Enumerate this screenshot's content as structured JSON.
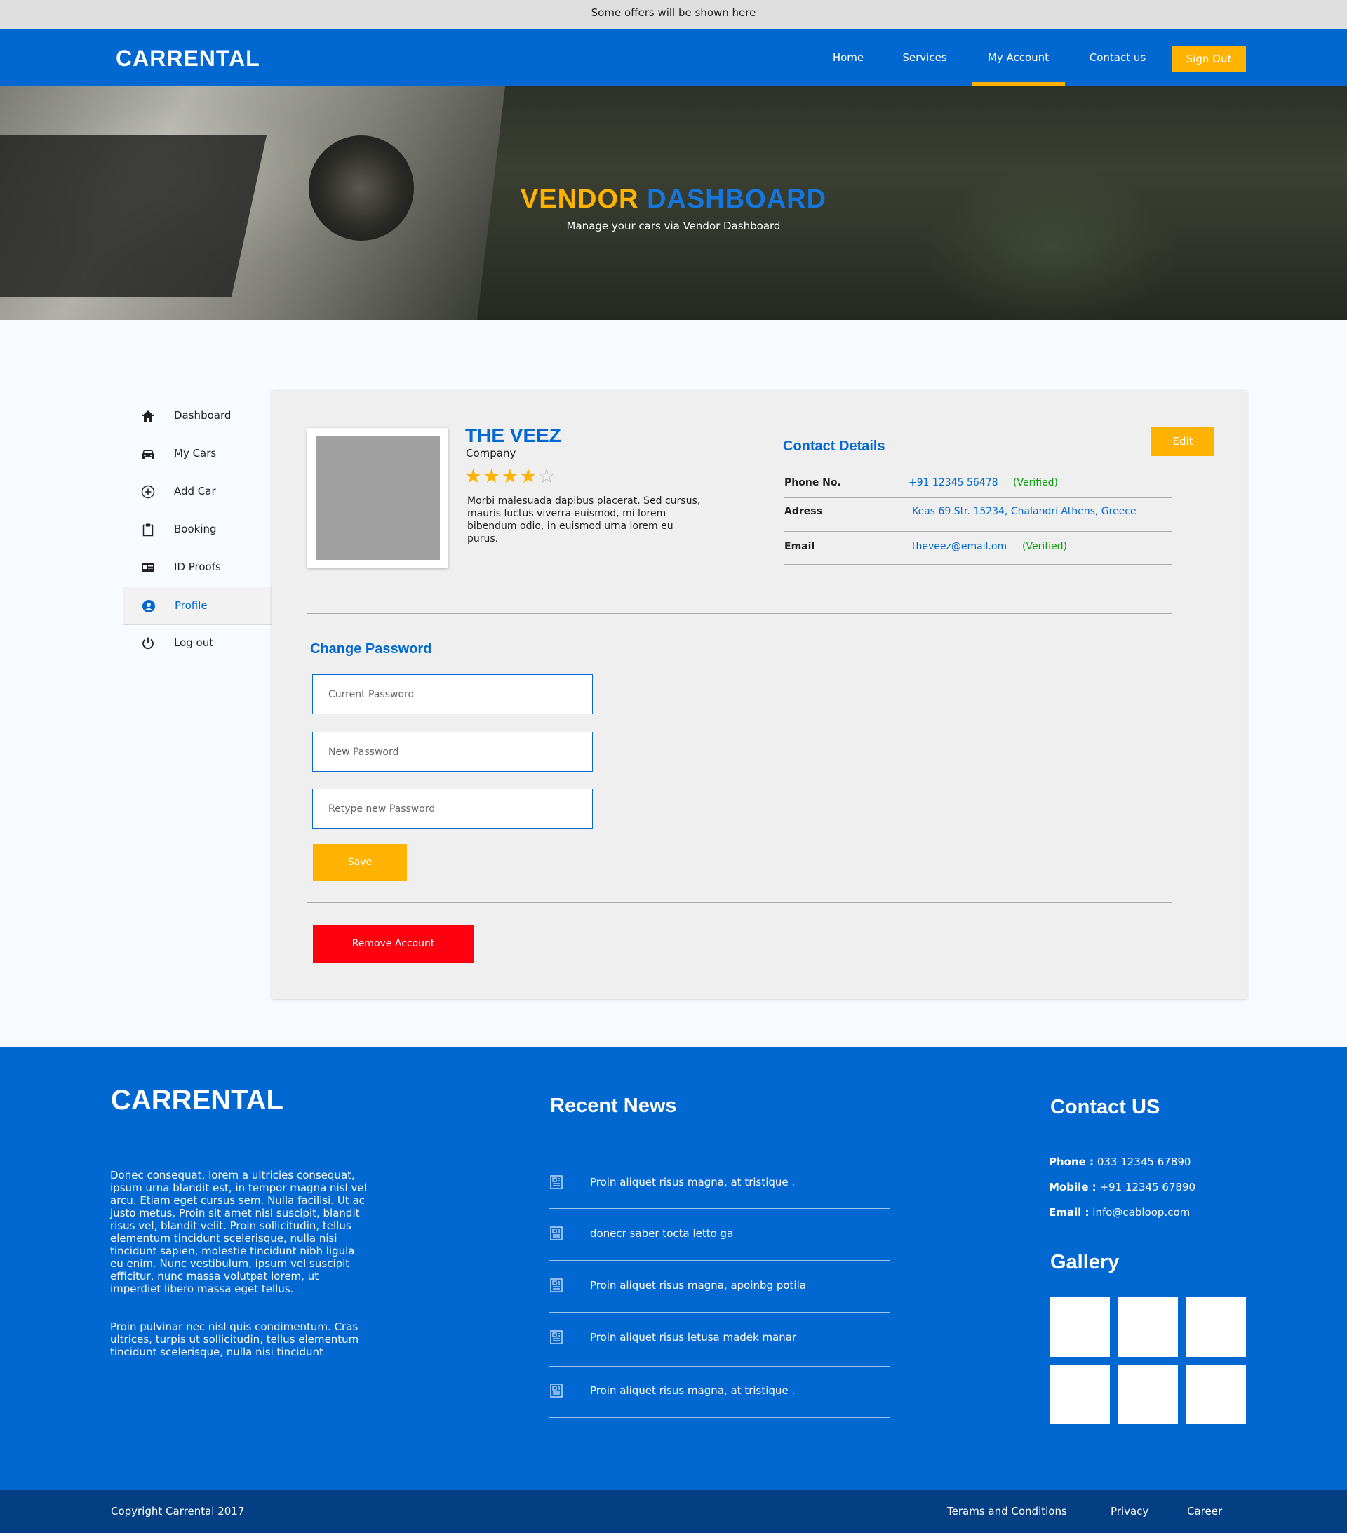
{
  "offer_bar": {
    "text": "Some offers will be shown here"
  },
  "nav": {
    "brand": "CARRENTAL",
    "links": [
      {
        "label": "Home"
      },
      {
        "label": "Services"
      },
      {
        "label": "My Account"
      },
      {
        "label": "Contact us"
      }
    ],
    "signout": "Sign Out"
  },
  "hero": {
    "title_part1": "VENDOR",
    "title_part2": "DASHBOARD",
    "subtitle": "Manage your cars via Vendor Dashboard"
  },
  "sidebar": {
    "items": [
      {
        "label": "Dashboard",
        "icon": "home-icon"
      },
      {
        "label": "My Cars",
        "icon": "car-icon"
      },
      {
        "label": "Add Car",
        "icon": "plus-circle-icon"
      },
      {
        "label": "Booking",
        "icon": "clipboard-icon"
      },
      {
        "label": "ID Proofs",
        "icon": "id-card-icon"
      },
      {
        "label": "Profile",
        "icon": "user-circle-icon"
      },
      {
        "label": "Log out",
        "icon": "power-icon"
      }
    ],
    "active": "Profile"
  },
  "profile": {
    "name": "THE VEEZ",
    "type": "Company",
    "rating": 4,
    "rating_max": 5,
    "description": "Morbi malesuada dapibus placerat. Sed cursus, mauris luctus viverra euismod, mi lorem bibendum odio, in euismod urna lorem eu purus."
  },
  "contact": {
    "heading": "Contact Details",
    "edit": "Edit",
    "rows": [
      {
        "label": "Phone No.",
        "value": "+91 12345 56478",
        "status": "(Verified)"
      },
      {
        "label": "Adress",
        "value": "Keas 69 Str. 15234, Chalandri Athens, Greece",
        "status": ""
      },
      {
        "label": "Email",
        "value": "theveez@email.om",
        "status": "(Verified)"
      }
    ]
  },
  "password": {
    "heading": "Change Password",
    "current_placeholder": "Current Password",
    "new_placeholder": "New Password",
    "retype_placeholder": "Retype new Password",
    "save": "Save"
  },
  "remove_account": "Remove Account",
  "footer": {
    "brand": "CARRENTAL",
    "para1": "Donec consequat, lorem a ultricies consequat, ipsum urna blandit est, in tempor magna nisl vel arcu. Etiam eget cursus sem. Nulla facilisi. Ut ac justo metus. Proin sit amet nisl suscipit, blandit risus vel, blandit velit. Proin sollicitudin, tellus elementum tincidunt scelerisque, nulla nisi tincidunt sapien, molestie tincidunt nibh ligula eu enim. Nunc vestibulum, ipsum vel suscipit efficitur, nunc massa volutpat lorem, ut imperdiet libero massa eget tellus.",
    "para2": "Proin pulvinar nec nisl quis condimentum. Cras ultrices, turpis ut sollicitudin, tellus elementum tincidunt scelerisque, nulla nisi tincidunt",
    "news_heading": "Recent News",
    "news": [
      "Proin aliquet risus magna, at tristique .",
      "donecr saber tocta letto ga",
      "Proin aliquet risus magna, apoinbg potila",
      "Proin aliquet risus letusa madek manar",
      "Proin aliquet risus magna, at tristique ."
    ],
    "contact_heading": "Contact US",
    "phone_label": "Phone :",
    "phone": "033 12345 67890",
    "mobile_label": "Mobile :",
    "mobile": "+91 12345 67890",
    "email_label": "Email :",
    "email": "info@cabloop.com",
    "gallery_heading": "Gallery"
  },
  "bottom": {
    "copyright": "Copyright Carrental 2017",
    "links": [
      "Terams and Conditions",
      "Privacy",
      "Career"
    ]
  },
  "colors": {
    "primary": "#0167d1",
    "accent": "#ffb300",
    "danger": "#ff0010",
    "verified": "#0a9a0a",
    "dark_blue": "#033f82"
  }
}
